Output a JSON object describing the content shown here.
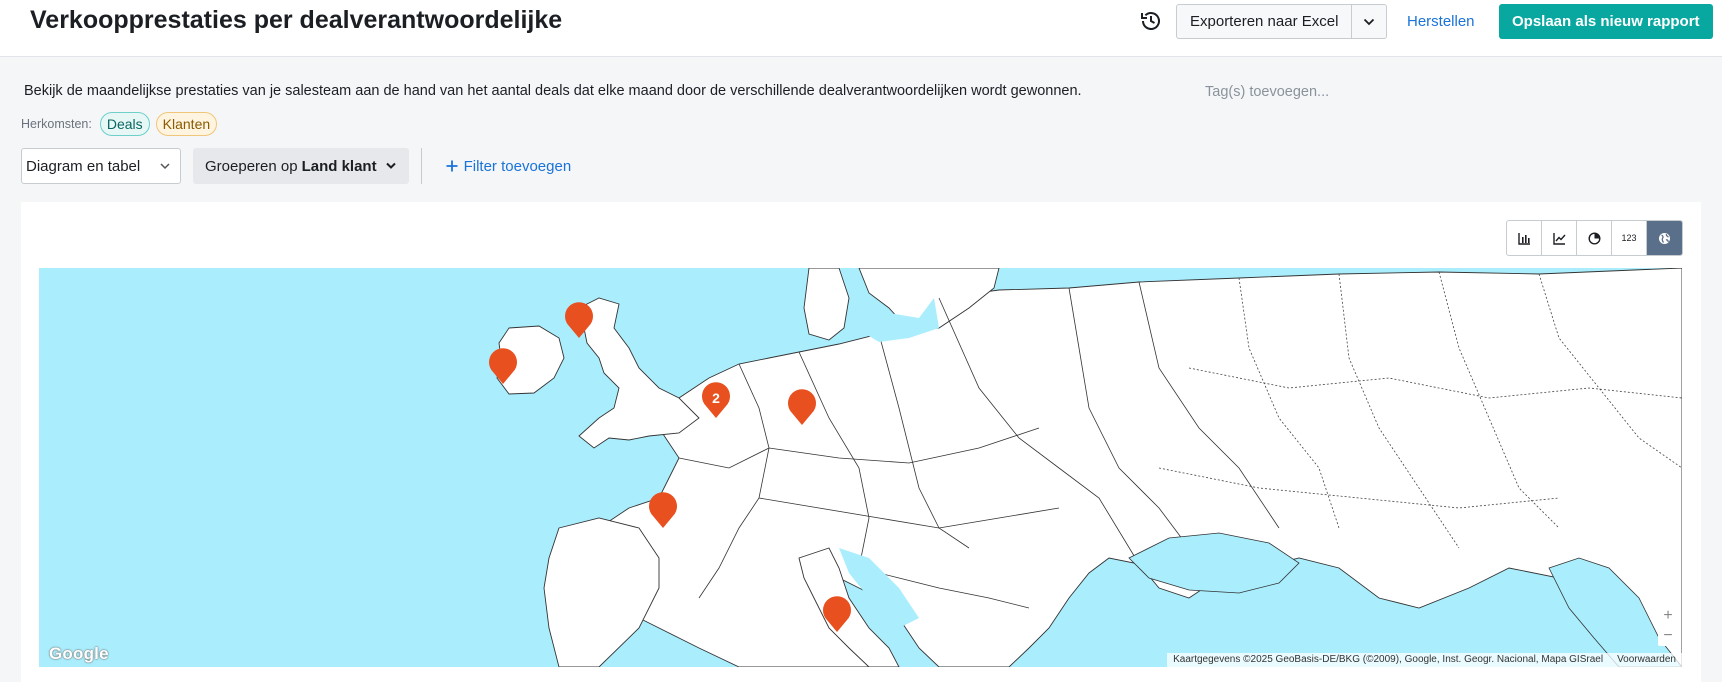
{
  "header": {
    "title": "Verkoopprestaties per dealverantwoordelijke",
    "export_label": "Exporteren naar Excel",
    "reset_label": "Herstellen",
    "save_label": "Opslaan als nieuw rapport"
  },
  "description": "Bekijk de maandelijkse prestaties van je salesteam aan de hand van het aantal deals dat elke maand door de verschillende dealverantwoordelijken wordt gewonnen.",
  "tags": {
    "placeholder": "Tag(s) toevoegen..."
  },
  "origins": {
    "label": "Herkomsten:",
    "items": [
      "Deals",
      "Klanten"
    ]
  },
  "toolbar": {
    "view_select": "Diagram en tabel",
    "group_prefix": "Groeperen op",
    "group_value": "Land klant",
    "filter_label": "Filter toevoegen"
  },
  "viz_buttons": [
    {
      "icon": "bar-chart-icon",
      "active": false
    },
    {
      "icon": "line-chart-icon",
      "active": false
    },
    {
      "icon": "pie-chart-icon",
      "active": false
    },
    {
      "icon": "number-icon",
      "label": "123",
      "active": false
    },
    {
      "icon": "globe-icon",
      "active": true
    }
  ],
  "map": {
    "cluster_count": "2",
    "google_logo": "Google",
    "attribution": "Kaartgegevens ©2025 GeoBasis-DE/BKG (©2009), Google, Inst. Geogr. Nacional, Mapa GISrael",
    "terms": "Voorwaarden",
    "zoom_in": "+",
    "zoom_out": "−",
    "marker_color": "#e8501f",
    "water_color": "#aaeefe"
  }
}
